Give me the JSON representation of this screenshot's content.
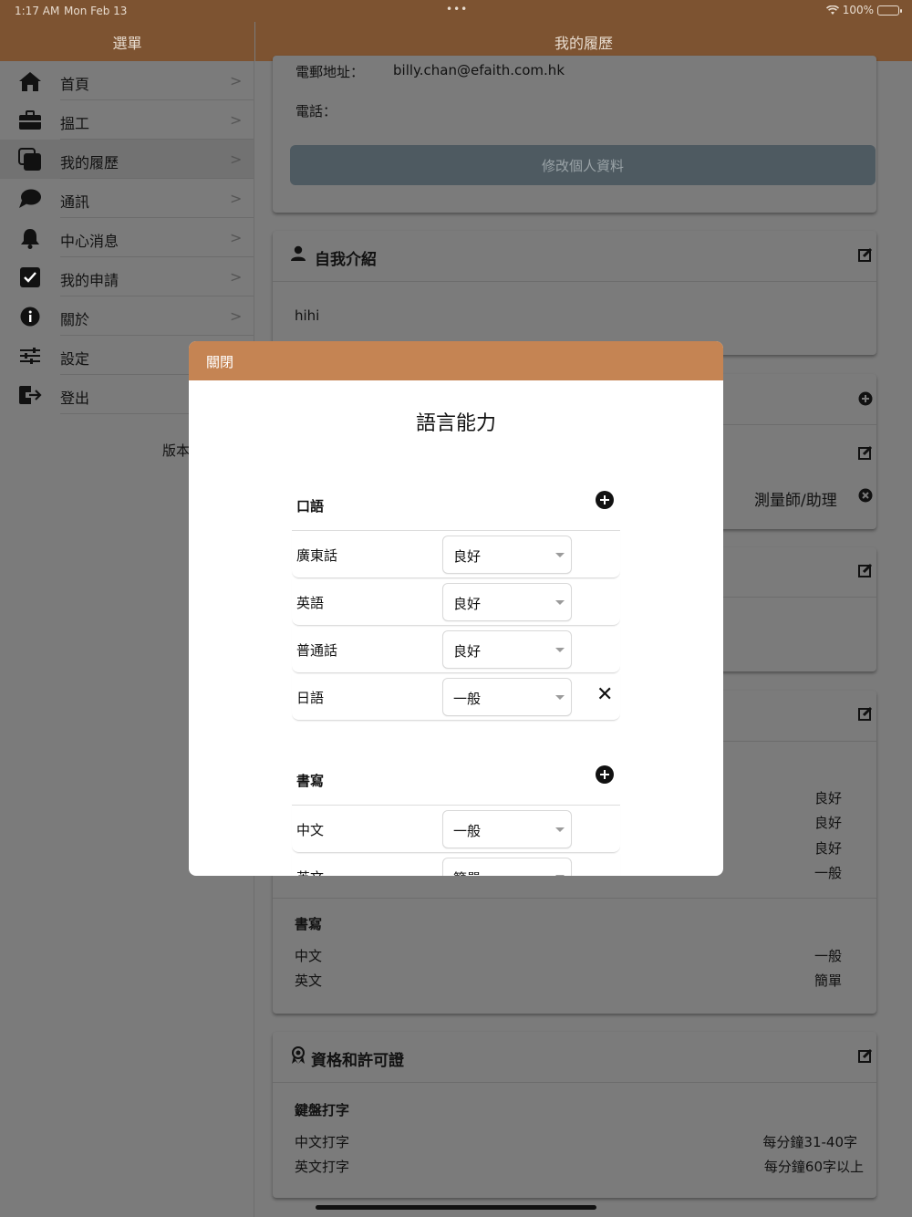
{
  "status_bar": {
    "time": "1:17 AM",
    "date": "Mon Feb 13",
    "dots": "•••",
    "battery": "100%"
  },
  "sidebar": {
    "title": "選單",
    "items": [
      {
        "label": "首頁",
        "icon": "home-icon",
        "chevron": true
      },
      {
        "label": "搵工",
        "icon": "briefcase-icon",
        "chevron": true
      },
      {
        "label": "我的履歷",
        "icon": "copy-icon",
        "chevron": true,
        "active": true
      },
      {
        "label": "通訊",
        "icon": "chat-icon",
        "chevron": true
      },
      {
        "label": "中心消息",
        "icon": "bell-icon",
        "chevron": true
      },
      {
        "label": "我的申請",
        "icon": "checkbox-icon",
        "chevron": true
      },
      {
        "label": "關於",
        "icon": "info-icon",
        "chevron": true
      },
      {
        "label": "設定",
        "icon": "sliders-icon",
        "chevron": false
      },
      {
        "label": "登出",
        "icon": "logout-icon",
        "chevron": false
      }
    ],
    "version": "版本"
  },
  "main": {
    "title": "我的履歷",
    "personal": {
      "email_label": "電郵地址：",
      "email": "billy.chan@efaith.com.hk",
      "phone_label": "電話：",
      "update_button": "修改個人資料"
    },
    "intro": {
      "title": "自我介紹",
      "text": "hihi"
    },
    "job": {
      "position": "測量師/助理"
    },
    "language_summary": {
      "spoken_levels": [
        "良好",
        "良好",
        "良好",
        "一般"
      ],
      "written_title": "書寫",
      "written": [
        {
          "lang": "中文",
          "level": "一般"
        },
        {
          "lang": "英文",
          "level": "簡單"
        }
      ]
    },
    "qualifications": {
      "title": "資格和許可證",
      "subtitle": "鍵盤打字",
      "items": [
        {
          "label": "中文打字",
          "value": "每分鐘31-40字"
        },
        {
          "label": "英文打字",
          "value": "每分鐘60字以上"
        }
      ]
    }
  },
  "modal": {
    "close": "關閉",
    "title": "語言能力",
    "spoken": {
      "title": "口語",
      "rows": [
        {
          "lang": "廣東話",
          "level": "良好"
        },
        {
          "lang": "英語",
          "level": "良好"
        },
        {
          "lang": "普通話",
          "level": "良好"
        },
        {
          "lang": "日語",
          "level": "一般",
          "delete": "✕"
        }
      ]
    },
    "written": {
      "title": "書寫",
      "rows": [
        {
          "lang": "中文",
          "level": "一般"
        },
        {
          "lang": "英文",
          "level": "簡單"
        }
      ]
    }
  },
  "colors": {
    "brand": "#7d5331",
    "modal_header": "#c58453",
    "dim_bg": "#7b7b7b"
  }
}
